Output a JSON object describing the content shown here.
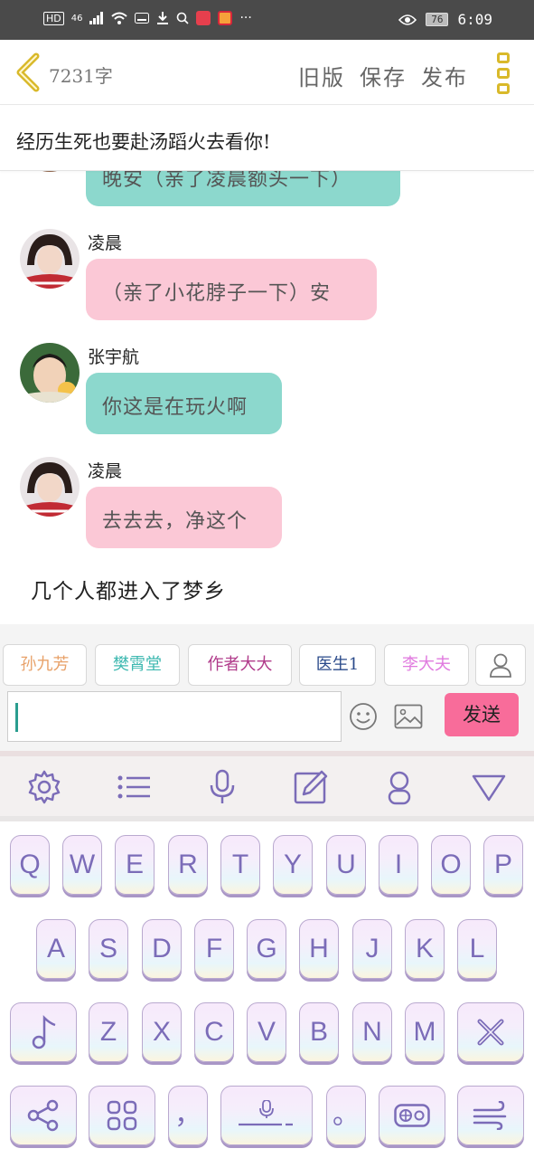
{
  "status_bar": {
    "network": "46",
    "battery": "76",
    "time": "6:09"
  },
  "header": {
    "word_count": "7231字",
    "old_version": "旧版",
    "save": "保存",
    "publish": "发布"
  },
  "story_title": "经历生死也要赴汤蹈火去看你!",
  "messages": [
    {
      "sender": "",
      "text": "晚安（亲了凌晨额头一下）",
      "style": "teal"
    },
    {
      "sender": "凌晨",
      "text": "（亲了小花脖子一下）安",
      "style": "pink"
    },
    {
      "sender": "张宇航",
      "text": "你这是在玩火啊",
      "style": "teal"
    },
    {
      "sender": "凌晨",
      "text": "去去去，净这个",
      "style": "pink"
    }
  ],
  "narration": "几个人都进入了梦乡",
  "characters": [
    {
      "name": "孙九芳",
      "color": "#e8a26a"
    },
    {
      "name": "樊霄堂",
      "color": "#3db8b0"
    },
    {
      "name": "作者大大",
      "color": "#b03a8a"
    },
    {
      "name": "医生1",
      "color": "#2a4a8a"
    },
    {
      "name": "李大夫",
      "color": "#e07adf"
    }
  ],
  "send_label": "发送",
  "keyboard": {
    "row1": [
      "Q",
      "W",
      "E",
      "R",
      "T",
      "Y",
      "U",
      "I",
      "O",
      "P"
    ],
    "row2": [
      "A",
      "S",
      "D",
      "F",
      "G",
      "H",
      "J",
      "K",
      "L"
    ],
    "row3": [
      "Z",
      "X",
      "C",
      "V",
      "B",
      "N",
      "M"
    ],
    "comma": "，",
    "period": "。"
  }
}
